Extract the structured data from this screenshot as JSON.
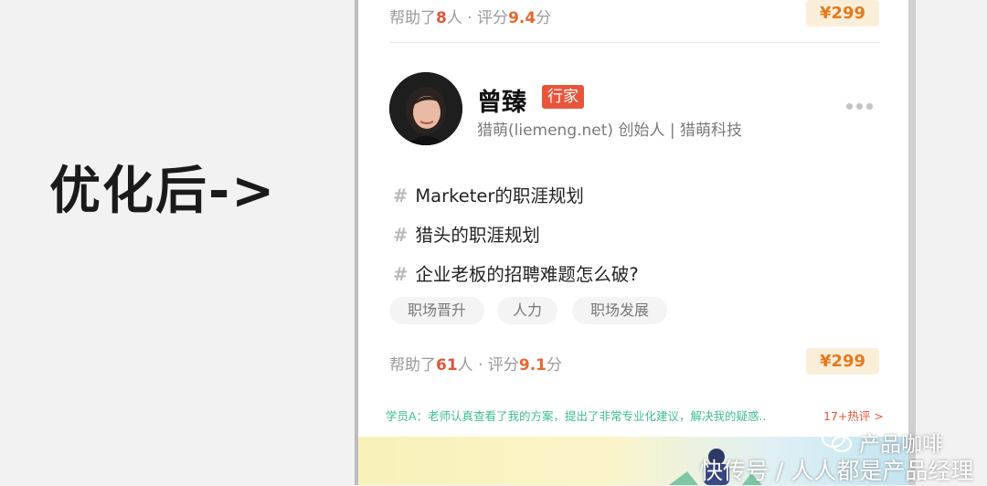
{
  "caption": "优化后->",
  "card_prev": {
    "help_prefix": "帮助了",
    "help_count": "8",
    "help_mid": "人 · 评分",
    "score": "9.4",
    "score_suffix": "分",
    "price": "¥299"
  },
  "card": {
    "name": "曾臻",
    "badge": "行家",
    "subtitle": "猎萌(liemeng.net) 创始人 | 猎萌科技",
    "topics": [
      "Marketer的职涯规划",
      "猎头的职涯规划",
      "企业老板的招聘难题怎么破?"
    ],
    "tags": [
      "职场晋升",
      "人力",
      "职场发展"
    ],
    "help_prefix": "帮助了",
    "help_count": "61",
    "help_mid": "人 · 评分",
    "score": "9.1",
    "score_suffix": "分",
    "price": "¥299",
    "hash_symbol": "#"
  },
  "review": {
    "text": "学员A：老师认真查看了我的方案，提出了非常专业化建议，解决我的疑惑..",
    "hot": "17+热评 >"
  },
  "watermark": {
    "account": "产品咖啡",
    "line": "快传号 / 人人都是产品经理"
  }
}
